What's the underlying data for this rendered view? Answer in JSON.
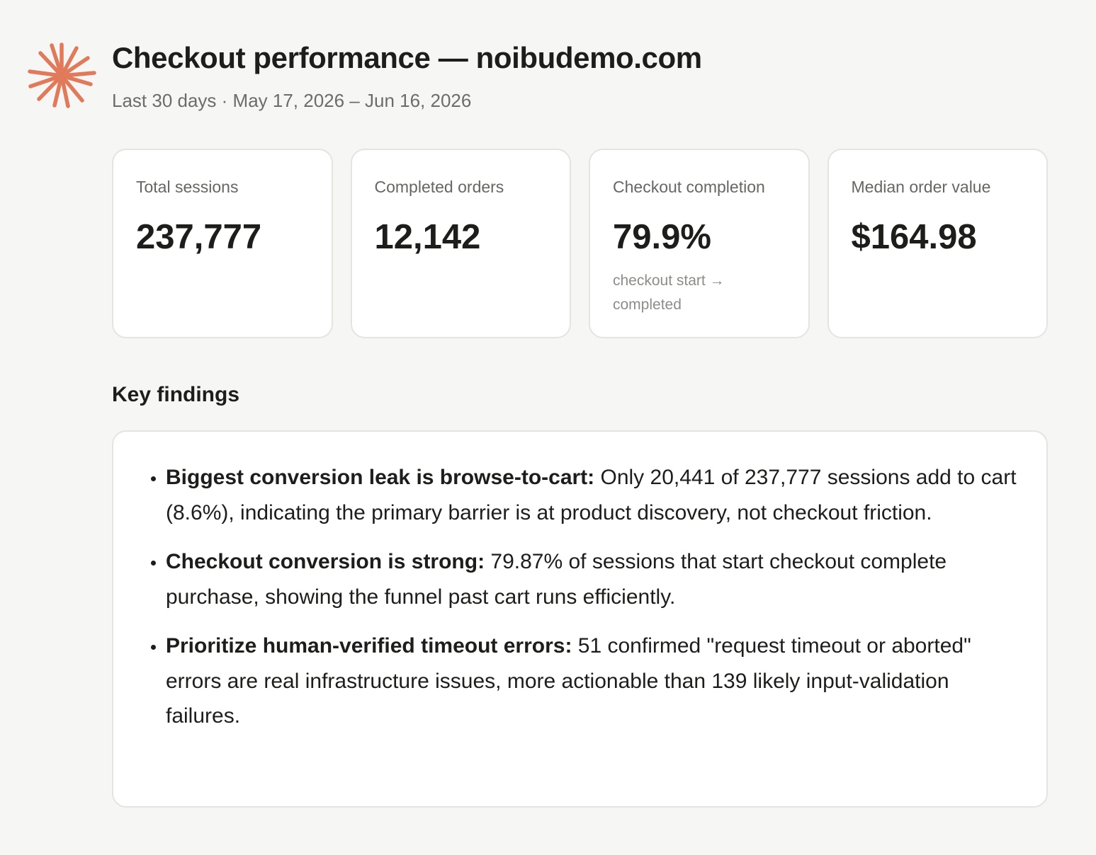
{
  "header": {
    "title": "Checkout performance — noibudemo.com",
    "subtitle": "Last 30 days · May 17, 2026 – Jun 16, 2026",
    "logo_icon": "starburst-icon",
    "accent_color": "#e07a5a"
  },
  "metrics": [
    {
      "label": "Total sessions",
      "value": "237,777"
    },
    {
      "label": "Completed orders",
      "value": "12,142"
    },
    {
      "label": "Checkout completion",
      "value": "79.9%",
      "note": "checkout start → completed"
    },
    {
      "label": "Median order value",
      "value": "$164.98"
    }
  ],
  "findings": {
    "title": "Key findings",
    "items": [
      {
        "heading": "Biggest conversion leak is browse-to-cart:",
        "text": " Only 20,441 of 237,777 sessions add to cart (8.6%), indicating the primary barrier is at product discovery, not checkout friction."
      },
      {
        "heading": "Checkout conversion is strong:",
        "text": " 79.87% of sessions that start checkout complete purchase, showing the funnel past cart runs efficiently."
      },
      {
        "heading": "Prioritize human-verified timeout errors:",
        "text": " 51 confirmed \"request timeout or aborted\" errors are real infrastructure issues, more actionable than 139 likely input-validation failures."
      }
    ]
  }
}
